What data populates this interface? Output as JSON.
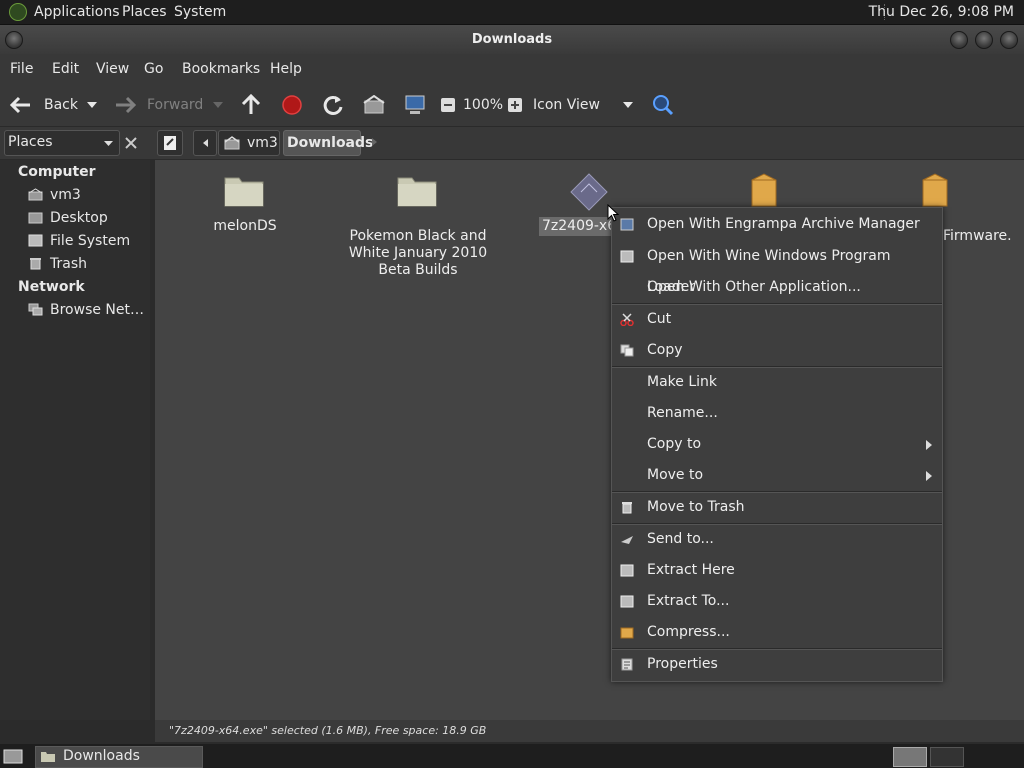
{
  "top_panel": {
    "menus": [
      "Applications",
      "Places",
      "System"
    ],
    "clock": "Thu Dec 26,  9:08 PM"
  },
  "window": {
    "title": "Downloads"
  },
  "menubar": [
    "File",
    "Edit",
    "View",
    "Go",
    "Bookmarks",
    "Help"
  ],
  "toolbar": {
    "back": "Back",
    "forward": "Forward",
    "zoom": "100%",
    "view_mode": "Icon View"
  },
  "location": {
    "sidebar_select": "Places",
    "crumbs": [
      "vm3",
      "Downloads"
    ]
  },
  "sidebar": {
    "computer_header": "Computer",
    "computer_items": [
      "vm3",
      "Desktop",
      "File System",
      "Trash"
    ],
    "network_header": "Network",
    "network_items": [
      "Browse Net…"
    ]
  },
  "files": [
    {
      "name": "melonDS",
      "type": "folder"
    },
    {
      "name": "Pokemon Black and White January 2010 Beta Builds",
      "type": "folder"
    },
    {
      "name": "7z2409-x64.exe",
      "visible_label": "7z2409-x6",
      "type": "exe",
      "selected": true
    },
    {
      "name": "",
      "type": "package"
    },
    {
      "name": "Firmware.",
      "type": "package"
    }
  ],
  "context_menu": {
    "groups": [
      [
        {
          "label": "Open With Engrampa Archive Manager",
          "icon": "archive-icon"
        },
        {
          "label": "Open With Wine Windows Program Loader",
          "icon": "wine-icon"
        },
        {
          "label": "Open With Other Application...",
          "icon": ""
        }
      ],
      [
        {
          "label": "Cut",
          "icon": "scissors-icon"
        },
        {
          "label": "Copy",
          "icon": "copy-icon"
        }
      ],
      [
        {
          "label": "Make Link",
          "icon": ""
        },
        {
          "label": "Rename...",
          "icon": ""
        },
        {
          "label": "Copy to",
          "icon": "",
          "submenu": true
        },
        {
          "label": "Move to",
          "icon": "",
          "submenu": true
        }
      ],
      [
        {
          "label": "Move to Trash",
          "icon": "trash-icon"
        }
      ],
      [
        {
          "label": "Send to...",
          "icon": "send-icon"
        },
        {
          "label": "Extract Here",
          "icon": "extract-icon"
        },
        {
          "label": "Extract To...",
          "icon": "extract-icon"
        },
        {
          "label": "Compress...",
          "icon": "compress-icon"
        }
      ],
      [
        {
          "label": "Properties",
          "icon": "properties-icon"
        }
      ]
    ]
  },
  "status": "\"7z2409-x64.exe\" selected (1.6 MB), Free space: 18.9 GB",
  "taskbar": {
    "window_button": "Downloads"
  },
  "colors": {
    "folder": "#c9c9b3",
    "package": "#e0a84a",
    "selection": "#6b6b6b"
  }
}
